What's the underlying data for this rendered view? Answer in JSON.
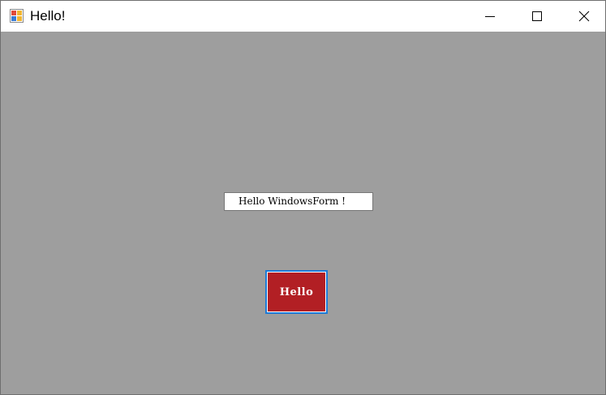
{
  "window": {
    "title": "Hello!",
    "app_icon": "winforms-app-icon",
    "controls": {
      "minimize_icon": "minimize-icon",
      "maximize_icon": "maximize-icon",
      "close_icon": "close-icon"
    }
  },
  "form": {
    "background_color": "#9e9e9e",
    "label_text": "Hello WindowsForm !",
    "button_label": "Hello",
    "button_color": "#b21f24",
    "button_focus_color": "#1e7ad6"
  }
}
